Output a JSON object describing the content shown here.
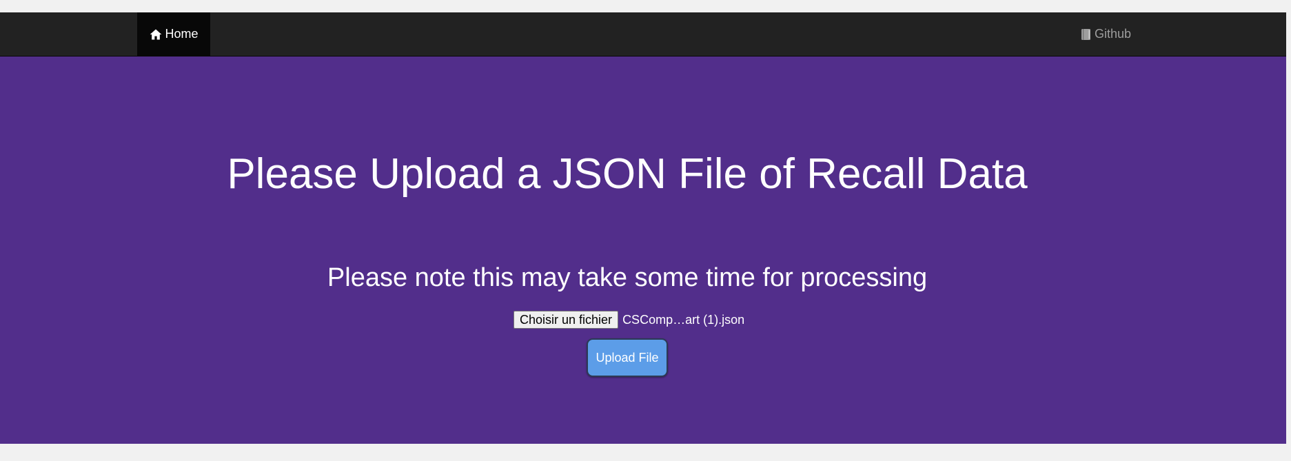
{
  "navbar": {
    "home_label": "Home",
    "home_icon": "home-icon",
    "github_label": "Github",
    "github_icon": "book-icon"
  },
  "hero": {
    "title": "Please Upload a JSON File of Recall Data",
    "note": "Please note this may take some time for processing",
    "file_input": {
      "button_label": "Choisir un fichier",
      "selected_file": "CSComp…art (1).json"
    },
    "upload_button_label": "Upload File"
  },
  "colors": {
    "navbar_bg": "#222222",
    "home_active_bg": "#080808",
    "hero_bg": "#522e8b",
    "upload_button_bg": "#5c9de8",
    "page_bg": "#f1f1f1"
  }
}
